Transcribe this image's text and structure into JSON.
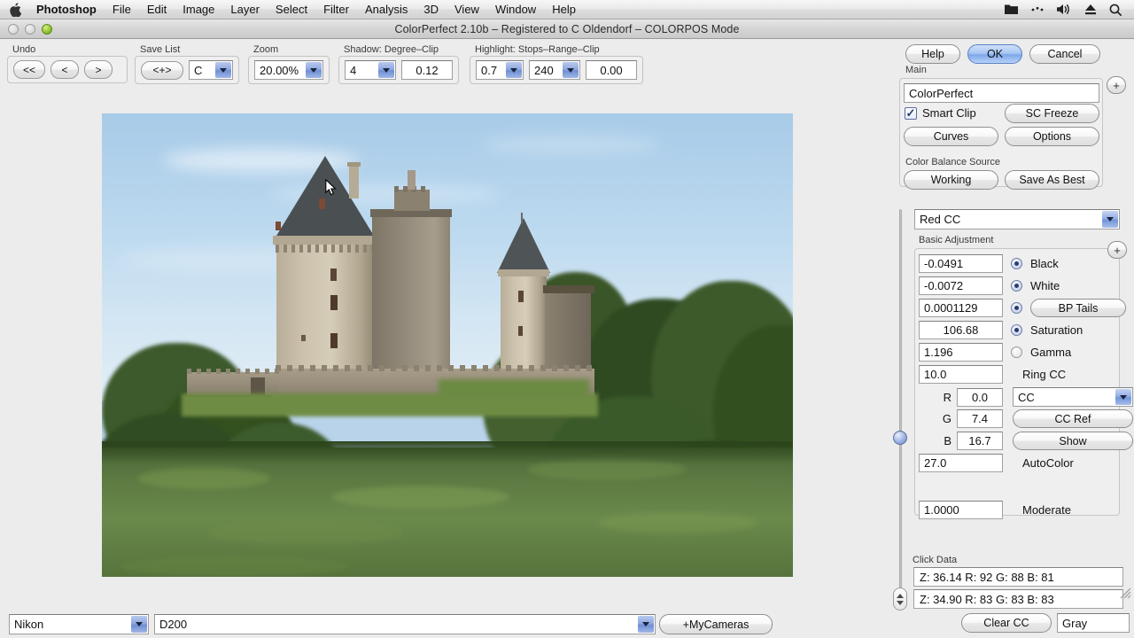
{
  "menubar": {
    "apple_icon": "apple-logo-icon",
    "items": [
      {
        "label": "Photoshop",
        "bold": true
      },
      {
        "label": "File",
        "bold": false
      },
      {
        "label": "Edit",
        "bold": false
      },
      {
        "label": "Image",
        "bold": false
      },
      {
        "label": "Layer",
        "bold": false
      },
      {
        "label": "Select",
        "bold": false
      },
      {
        "label": "Filter",
        "bold": false
      },
      {
        "label": "Analysis",
        "bold": false
      },
      {
        "label": "3D",
        "bold": false
      },
      {
        "label": "View",
        "bold": false
      },
      {
        "label": "Window",
        "bold": false
      },
      {
        "label": "Help",
        "bold": false
      }
    ],
    "status_icons": [
      "folder-icon",
      "spotlight-dots-icon",
      "volume-icon",
      "eject-icon",
      "search-icon"
    ]
  },
  "window": {
    "title": "ColorPerfect 2.10b – Registered to C Oldendorf – COLORPOS Mode",
    "traffic_lights": [
      "close-button",
      "minimize-button",
      "zoom-button"
    ]
  },
  "optionbar": {
    "undo": {
      "label": "Undo",
      "buttons": [
        "<<",
        "<",
        ">"
      ]
    },
    "save_list": {
      "label": "Save List",
      "button": "<+>",
      "value": "C"
    },
    "zoom": {
      "label": "Zoom",
      "value": "20.00%"
    },
    "shadow": {
      "label": "Shadow: Degree–Clip",
      "degree": "4",
      "clip": "0.12"
    },
    "highlight": {
      "label": "Highlight: Stops–Range–Clip",
      "stops": "0.7",
      "range": "240",
      "clip": "0.00"
    }
  },
  "rightpanel": {
    "top_buttons": [
      {
        "label": "Help",
        "default": false
      },
      {
        "label": "OK",
        "default": true
      },
      {
        "label": "Cancel",
        "default": false
      }
    ],
    "main": {
      "label": "Main",
      "value": "ColorPerfect",
      "plus": "+",
      "smart_clip_label": "Smart Clip",
      "smart_clip_checked": true,
      "sc_freeze": "SC Freeze",
      "curves": "Curves",
      "options": "Options"
    },
    "color_balance_source": {
      "label": "Color Balance Source",
      "working": "Working",
      "save_as_best": "Save As Best"
    },
    "channel_select": {
      "value": "Red CC"
    },
    "basic_adjustment": {
      "label": "Basic Adjustment",
      "plus": "+",
      "rows": [
        {
          "value": "-0.0491",
          "label": "Black",
          "control": "radio",
          "selected": true
        },
        {
          "value": "-0.0072",
          "label": "White",
          "control": "radio",
          "selected": true
        },
        {
          "value": "0.0001129",
          "label": "BP Tails",
          "control": "radio-button",
          "selected": true
        },
        {
          "value": "106.68",
          "label": "Saturation",
          "control": "radio",
          "selected": true
        },
        {
          "value": "1.196",
          "label": "Gamma",
          "control": "radio",
          "selected": false
        },
        {
          "value": "10.0",
          "label": "Ring CC",
          "control": "text",
          "selected": false
        }
      ],
      "rgb": [
        {
          "channel": "R",
          "value": "0.0"
        },
        {
          "channel": "G",
          "value": "7.4"
        },
        {
          "channel": "B",
          "value": "16.7"
        }
      ],
      "cc_dropdown": "CC",
      "cc_ref": "CC Ref",
      "show": "Show",
      "autocolor_value": "27.0",
      "autocolor_label": "AutoColor",
      "moderate_value": "1.0000",
      "moderate_label": "Moderate"
    },
    "click_data": {
      "label": "Click Data",
      "rows": [
        "Z:  36.14  R: 92 G: 88 B: 81",
        "Z:  34.90 R: 83 G: 83 B: 83"
      ],
      "clear_cc": "Clear CC",
      "gray_value": "Gray"
    }
  },
  "bottombar": {
    "camera_make": "Nikon",
    "camera_model": "D200",
    "my_cameras": "+MyCameras"
  },
  "colors": {
    "accent_blue": "#7ea8ea",
    "panel_bg": "#ececec",
    "field_bg": "#ffffff",
    "menu_text": "#111111"
  }
}
